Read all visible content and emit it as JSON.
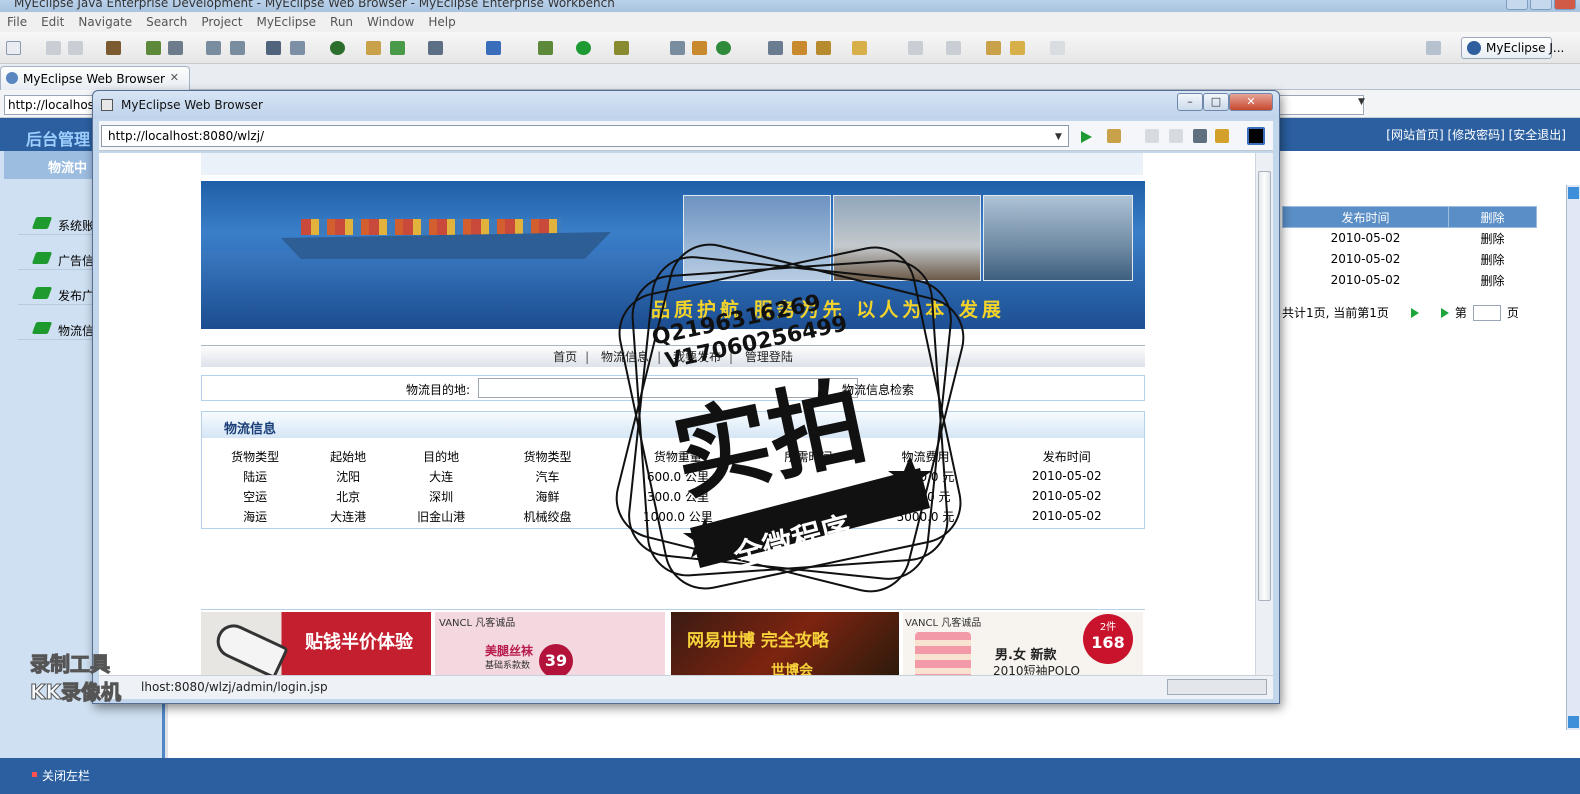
{
  "ide": {
    "title": "MyEclipse Java Enterprise Development - MyEclipse Web Browser - MyEclipse Enterprise Workbench",
    "menu": [
      "File",
      "Edit",
      "Navigate",
      "Search",
      "Project",
      "MyEclipse",
      "Run",
      "Window",
      "Help"
    ],
    "perspective": "MyEclipse J...",
    "editor_tab": "MyEclipse Web Browser",
    "background_url": "http://localhost"
  },
  "admin": {
    "logo": "后台管理",
    "top_links": "[网站首页] [修改密码] [安全退出]",
    "left_header": "物流中",
    "left_items": [
      "系统账",
      "广告信",
      "发布广",
      "物流信"
    ],
    "table": {
      "headers": [
        "发布时间",
        "删除"
      ],
      "rows": [
        [
          "2010-05-02",
          "删除"
        ],
        [
          "2010-05-02",
          "删除"
        ],
        [
          "2010-05-02",
          "删除"
        ]
      ]
    },
    "pager_text": "共计1页, 当前第1页",
    "pager_page_label": "第",
    "pager_page_suffix": "页",
    "bottom_toggle": "关闭左栏"
  },
  "popup": {
    "title": "MyEclipse Web Browser",
    "url": "http://localhost:8080/wlzj/",
    "status_url": "http://localhost:8080/wlzj/admin/login.jsp",
    "status_visible": "lhost:8080/wlzj/admin/login.jsp"
  },
  "site": {
    "slogan": "品质护航 服务为先 以人为本 发展",
    "nav": [
      "首页",
      "物流信息",
      "我要发布",
      "管理登陆"
    ],
    "search_label": "物流目的地:",
    "search_button": "物流信息检索",
    "section_title": "物流信息",
    "table": {
      "headers": [
        "货物类型",
        "起始地",
        "目的地",
        "货物类型",
        "货物重量",
        "所需时间",
        "物流费用",
        "发布时间"
      ],
      "rows": [
        [
          "陆运",
          "沈阳",
          "大连",
          "汽车",
          "600.0 公里",
          "",
          "1200.0 元",
          "2010-05-02"
        ],
        [
          "空运",
          "北京",
          "深圳",
          "海鲜",
          "300.0 公里",
          "",
          "800.0 元",
          "2010-05-02"
        ],
        [
          "海运",
          "大连港",
          "旧金山港",
          "机械绞盘",
          "1000.0 公里",
          "天",
          "5000.0 元",
          "2010-05-02"
        ]
      ]
    },
    "ads": {
      "ad1": "贴钱半价体验",
      "ad2_brand": "VANCL 凡客诚品",
      "ad2_line1": "美腿丝袜",
      "ad2_line2": "基础系款数",
      "ad2_price": "39",
      "ad3_line1": "网易世博 完全攻略",
      "ad3_line2": "世博会",
      "ad4_brand": "VANCL 凡客诚品",
      "ad4_line1": "男.女 新款",
      "ad4_line2": "2010短袖POLO",
      "ad4_badge": "2件",
      "ad4_price": "168"
    }
  },
  "watermark": {
    "qq1": "Q2196316269",
    "qq2": "V17060256499",
    "big": "实拍",
    "ribbon": "全微程序",
    "recorder_line1": "录制工具",
    "recorder_line2": "KK录像机"
  }
}
